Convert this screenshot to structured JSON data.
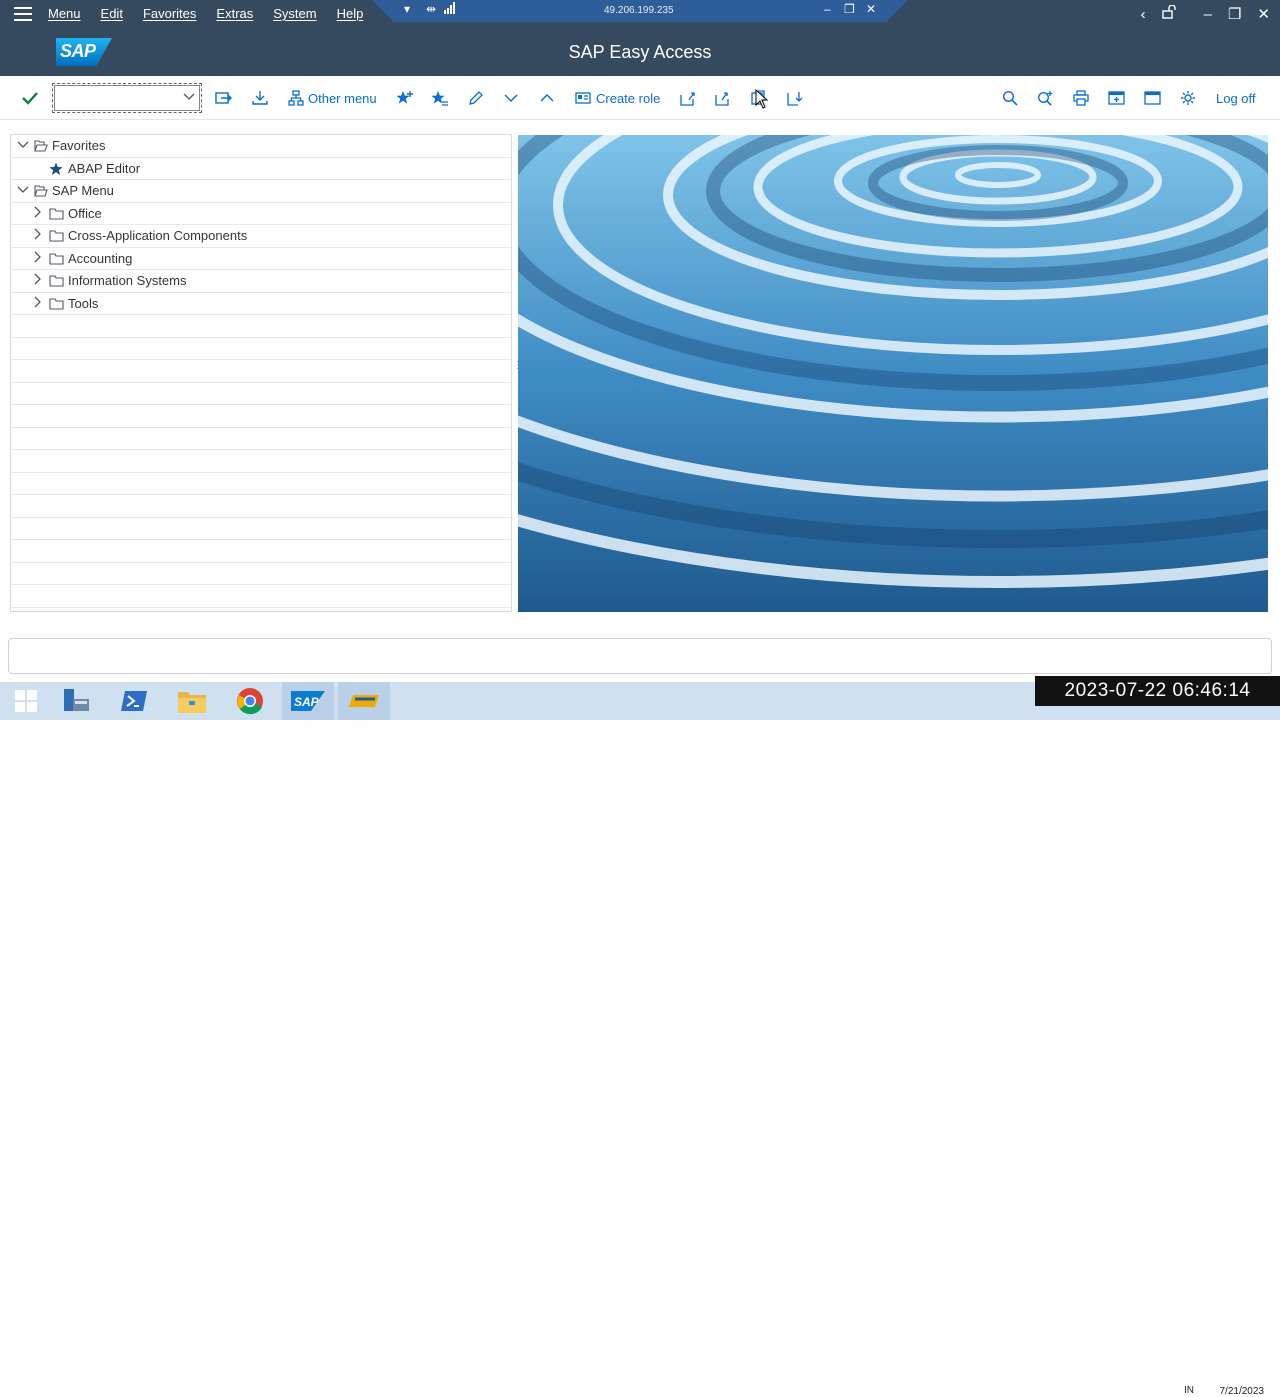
{
  "menu": {
    "items": [
      "Menu",
      "Edit",
      "Favorites",
      "Extras",
      "System",
      "Help"
    ]
  },
  "remote": {
    "ip": "49.206.199.235"
  },
  "header": {
    "title": "SAP Easy Access",
    "logo": "SAP"
  },
  "toolbar": {
    "command_value": "",
    "other_menu_label": "Other menu",
    "create_role_label": "Create role",
    "log_off_label": "Log off"
  },
  "tree": {
    "favorites_label": "Favorites",
    "favorites_items": [
      "ABAP Editor"
    ],
    "sap_menu_label": "SAP Menu",
    "sap_menu_items": [
      "Office",
      "Cross-Application Components",
      "Accounting",
      "Information Systems",
      "Tools"
    ]
  },
  "overlay": {
    "timestamp": "2023-07-22  06:46:14"
  },
  "tray": {
    "lang": "IN",
    "date": "7/21/2023"
  },
  "colors": {
    "shell": "#354a5f",
    "accent": "#0a6ed1",
    "rdp_bar": "#2e5e9a",
    "taskbar": "#cfe0f1"
  }
}
